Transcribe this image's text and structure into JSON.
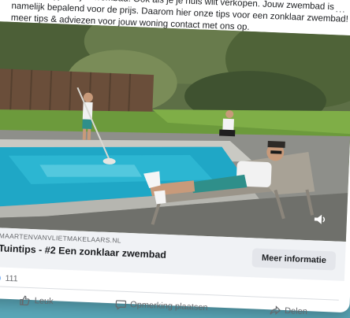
{
  "post": {
    "text_lines": [
      "...gebruikt jij van je zwembad. Ook als je je huis wilt verkopen. Jouw zwembad is",
      "namelijk bepalend voor de prijs. Daarom hier onze tips voor een zonklaar zwembad! En neem voor",
      "meer tips & adviezen voor jouw woning contact met ons op."
    ],
    "more_options": "..."
  },
  "link_preview": {
    "domain": "MAARTENVANVLIETMAKELAARS.NL",
    "title": "Tuintips - #2 Een zonklaar zwembad",
    "cta_label": "Meer informatie"
  },
  "reactions": {
    "count": "111"
  },
  "actions": {
    "like_label": "Leuk",
    "comment_label": "Opmerking plaatsen",
    "share_label": "Delen"
  },
  "colors": {
    "facebook_blue": "#1877f2",
    "pool_water": "#1fa7c6",
    "lawn": "#6c9a3c"
  },
  "icons": [
    "more-options-icon",
    "volume-icon",
    "like-badge-icon",
    "like-icon",
    "comment-icon",
    "share-icon"
  ]
}
